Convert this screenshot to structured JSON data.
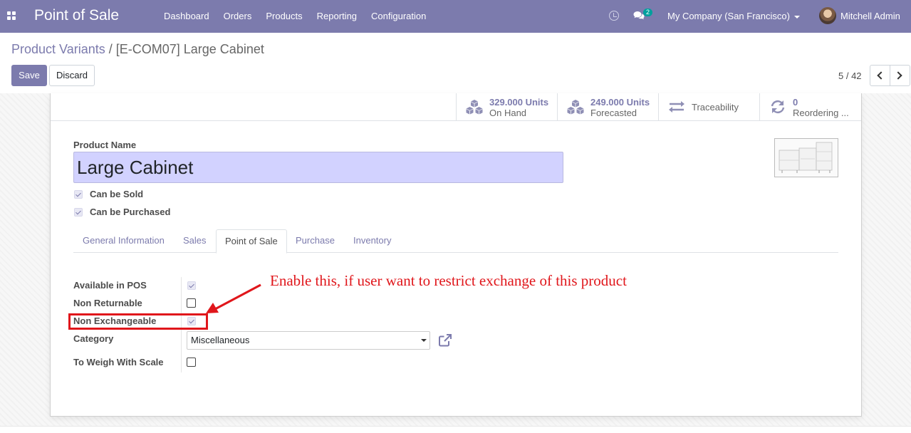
{
  "navbar": {
    "brand": "Point of Sale",
    "menu": [
      "Dashboard",
      "Orders",
      "Products",
      "Reporting",
      "Configuration"
    ],
    "chat_count": "2",
    "company": "My Company (San Francisco)",
    "user": "Mitchell Admin",
    "icons": [
      "apps-icon",
      "clock-icon",
      "chat-icon",
      "avatar"
    ]
  },
  "breadcrumb": {
    "parent": "Product Variants",
    "separator": "/",
    "current": "[E-COM07] Large Cabinet"
  },
  "toolbar": {
    "save_label": "Save",
    "discard_label": "Discard",
    "pager": "5 / 42"
  },
  "smart_buttons": {
    "on_hand_value": "329.000 Units",
    "on_hand_label": "On Hand",
    "forecasted_value": "249.000 Units",
    "forecasted_label": "Forecasted",
    "traceability_label": "Traceability",
    "reordering_value": "0",
    "reordering_label": "Reordering ..."
  },
  "form": {
    "product_name_label": "Product Name",
    "product_name": "Large Cabinet",
    "can_be_sold_label": "Can be Sold",
    "can_be_sold": true,
    "can_be_purchased_label": "Can be Purchased",
    "can_be_purchased": true
  },
  "tabs": [
    {
      "label": "General Information",
      "active": false
    },
    {
      "label": "Sales",
      "active": false
    },
    {
      "label": "Point of Sale",
      "active": true
    },
    {
      "label": "Purchase",
      "active": false
    },
    {
      "label": "Inventory",
      "active": false
    }
  ],
  "pos_fields": {
    "available_in_pos_label": "Available in POS",
    "available_in_pos": true,
    "non_returnable_label": "Non Returnable",
    "non_returnable": false,
    "non_exchangeable_label": "Non Exchangeable",
    "non_exchangeable": true,
    "category_label": "Category",
    "category_value": "Miscellaneous",
    "to_weigh_label": "To Weigh With Scale",
    "to_weigh": false
  },
  "annotation": {
    "text": "Enable this, if user want to restrict exchange of this product",
    "color": "#e0161b"
  },
  "colors": {
    "brand": "#7c7bad",
    "name_field_bg": "#d2d2ff"
  }
}
